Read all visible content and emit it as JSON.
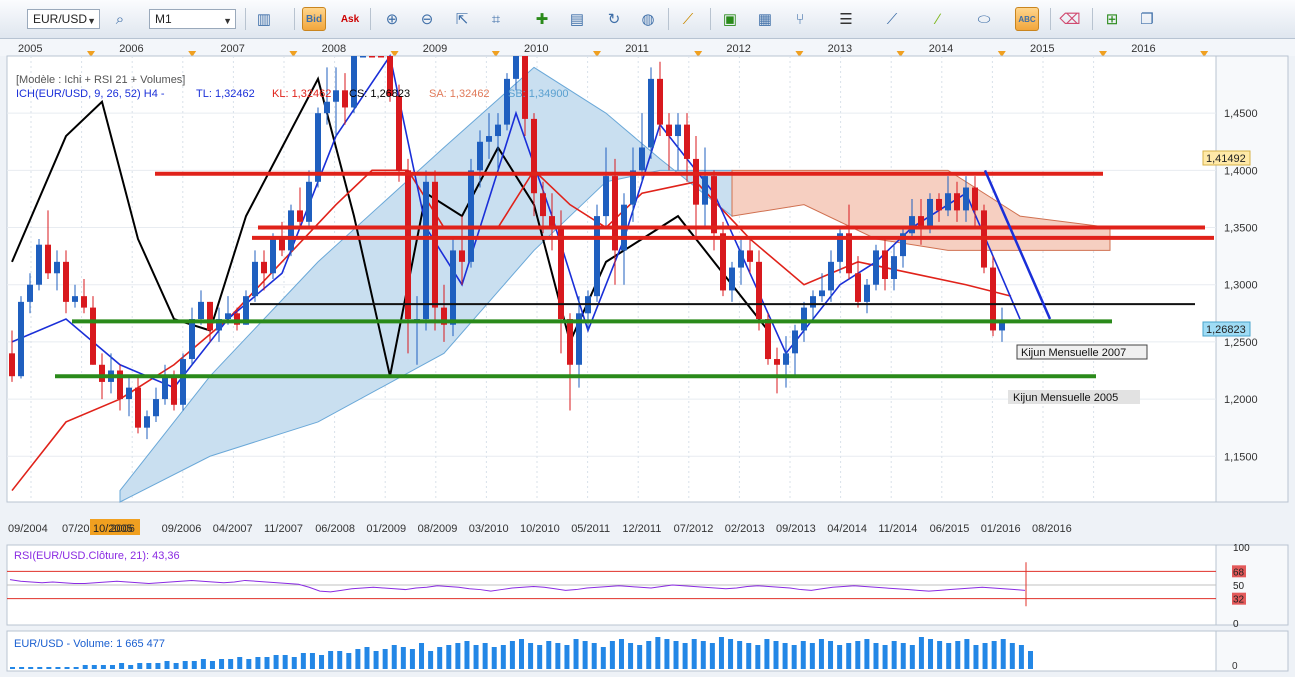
{
  "toolbar": {
    "symbol": "EUR/USD",
    "timeframe": "M1",
    "bid_label": "Bid",
    "ask_label": "Ask",
    "tool_icons": [
      "chart-type-icon",
      "indicator-icon",
      "zoom-in-icon",
      "zoom-out-icon",
      "cursor-icon",
      "fibonacci-icon",
      "note-icon",
      "refresh-icon",
      "globe-icon",
      "ruler-icon",
      "picture-icon",
      "screenshot-icon",
      "pitchfork-icon",
      "horizontal-lines-icon",
      "trendline-icon",
      "line-draw-icon",
      "ellipse-icon",
      "text-tool-icon",
      "eraser-icon",
      "tree-icon",
      "window-icon"
    ]
  },
  "main_chart": {
    "legend_line1": "[Modèle : Ichi + RSI 21 + Volumes]",
    "legend_ich": "ICH(EUR/USD, 9, 26, 52) H4 -",
    "legend_tl": "TL: 1,32462",
    "legend_kl": "KL: 1,32462",
    "legend_cs": "CS: 1,26823",
    "legend_sa": "SA: 1,32462",
    "legend_sb": "SB: 1,34900",
    "year_labels": [
      "2005",
      "2006",
      "2007",
      "2008",
      "2009",
      "2010",
      "2011",
      "2012",
      "2013",
      "2014",
      "2015",
      "2016"
    ],
    "date_labels": [
      "09/2004",
      "07/2005",
      "10/2005",
      "2006",
      "09/2006",
      "04/2007",
      "11/2007",
      "06/2008",
      "01/2009",
      "08/2009",
      "03/2010",
      "10/2010",
      "05/2011",
      "12/2011",
      "07/2012",
      "02/2013",
      "09/2013",
      "04/2014",
      "11/2014",
      "06/2015",
      "01/2016",
      "08/2016"
    ],
    "highlighted_date": "10/2005",
    "price_ticks": [
      "1,4500",
      "1,4000",
      "1,3500",
      "1,3000",
      "1,2500",
      "1,2000",
      "1,1500"
    ],
    "price_tag_high": "1,41492",
    "price_tag_last": "1,26823",
    "label_kijun_2007": "Kijun Mensuelle 2007",
    "label_kijun_2005": "Kijun Mensuelle 2005"
  },
  "rsi_panel": {
    "title": "RSI(EUR/USD.Clôture, 21): 43,36",
    "ticks": [
      "100",
      "68",
      "50",
      "32",
      "0"
    ]
  },
  "volume_panel": {
    "title": "EUR/USD - Volume: 1 665 477",
    "ticks": [
      "0"
    ]
  },
  "colors": {
    "bull": "#1f5fbf",
    "bear": "#d8191e",
    "kijun": "#e0221a",
    "tenkan": "#1a2fd8",
    "chikou": "#000000",
    "cloud_bull": "#c9dff0",
    "cloud_bear": "#f6cfc1",
    "support": "#2a8a1a",
    "rsi": "#8a2be2",
    "volume": "#2387e6"
  },
  "chart_data": {
    "type": "candlestick",
    "instrument": "EUR/USD",
    "interval": "monthly",
    "ylim": [
      1.11,
      1.5
    ],
    "candles_ohlc": [
      [
        1.24,
        1.26,
        1.215,
        1.22
      ],
      [
        1.22,
        1.29,
        1.218,
        1.285
      ],
      [
        1.285,
        1.31,
        1.275,
        1.3
      ],
      [
        1.3,
        1.34,
        1.295,
        1.335
      ],
      [
        1.335,
        1.365,
        1.305,
        1.31
      ],
      [
        1.31,
        1.33,
        1.295,
        1.32
      ],
      [
        1.32,
        1.33,
        1.275,
        1.285
      ],
      [
        1.285,
        1.3,
        1.28,
        1.29
      ],
      [
        1.29,
        1.305,
        1.275,
        1.28
      ],
      [
        1.28,
        1.29,
        1.23,
        1.23
      ],
      [
        1.23,
        1.24,
        1.2,
        1.215
      ],
      [
        1.215,
        1.24,
        1.205,
        1.225
      ],
      [
        1.225,
        1.23,
        1.19,
        1.2
      ],
      [
        1.2,
        1.22,
        1.185,
        1.21
      ],
      [
        1.21,
        1.22,
        1.17,
        1.175
      ],
      [
        1.175,
        1.19,
        1.165,
        1.185
      ],
      [
        1.185,
        1.21,
        1.18,
        1.2
      ],
      [
        1.2,
        1.23,
        1.195,
        1.22
      ],
      [
        1.22,
        1.225,
        1.19,
        1.195
      ],
      [
        1.195,
        1.24,
        1.19,
        1.235
      ],
      [
        1.235,
        1.28,
        1.23,
        1.27
      ],
      [
        1.27,
        1.295,
        1.265,
        1.285
      ],
      [
        1.285,
        1.285,
        1.25,
        1.26
      ],
      [
        1.26,
        1.28,
        1.25,
        1.27
      ],
      [
        1.27,
        1.29,
        1.265,
        1.275
      ],
      [
        1.275,
        1.28,
        1.26,
        1.265
      ],
      [
        1.265,
        1.295,
        1.265,
        1.29
      ],
      [
        1.29,
        1.33,
        1.285,
        1.32
      ],
      [
        1.32,
        1.33,
        1.295,
        1.31
      ],
      [
        1.31,
        1.345,
        1.305,
        1.34
      ],
      [
        1.34,
        1.355,
        1.325,
        1.33
      ],
      [
        1.33,
        1.37,
        1.325,
        1.365
      ],
      [
        1.365,
        1.385,
        1.35,
        1.355
      ],
      [
        1.355,
        1.4,
        1.35,
        1.39
      ],
      [
        1.39,
        1.455,
        1.385,
        1.45
      ],
      [
        1.45,
        1.49,
        1.44,
        1.46
      ],
      [
        1.46,
        1.49,
        1.43,
        1.47
      ],
      [
        1.47,
        1.485,
        1.44,
        1.455
      ],
      [
        1.455,
        1.55,
        1.45,
        1.53
      ],
      [
        1.53,
        1.59,
        1.52,
        1.58
      ],
      [
        1.58,
        1.6,
        1.54,
        1.56
      ],
      [
        1.56,
        1.58,
        1.55,
        1.555
      ],
      [
        1.555,
        1.56,
        1.46,
        1.465
      ],
      [
        1.465,
        1.475,
        1.39,
        1.4
      ],
      [
        1.4,
        1.41,
        1.24,
        1.27
      ],
      [
        1.27,
        1.29,
        1.23,
        1.27
      ],
      [
        1.27,
        1.4,
        1.26,
        1.39
      ],
      [
        1.39,
        1.4,
        1.26,
        1.28
      ],
      [
        1.28,
        1.3,
        1.25,
        1.265
      ],
      [
        1.265,
        1.34,
        1.255,
        1.33
      ],
      [
        1.33,
        1.36,
        1.3,
        1.32
      ],
      [
        1.32,
        1.41,
        1.315,
        1.4
      ],
      [
        1.4,
        1.435,
        1.385,
        1.425
      ],
      [
        1.425,
        1.45,
        1.41,
        1.43
      ],
      [
        1.43,
        1.45,
        1.4,
        1.44
      ],
      [
        1.44,
        1.485,
        1.435,
        1.48
      ],
      [
        1.48,
        1.515,
        1.47,
        1.5
      ],
      [
        1.5,
        1.51,
        1.43,
        1.445
      ],
      [
        1.445,
        1.45,
        1.36,
        1.38
      ],
      [
        1.38,
        1.39,
        1.345,
        1.36
      ],
      [
        1.36,
        1.38,
        1.33,
        1.35
      ],
      [
        1.35,
        1.365,
        1.24,
        1.27
      ],
      [
        1.27,
        1.275,
        1.19,
        1.23
      ],
      [
        1.23,
        1.29,
        1.21,
        1.275
      ],
      [
        1.275,
        1.295,
        1.26,
        1.29
      ],
      [
        1.29,
        1.37,
        1.285,
        1.36
      ],
      [
        1.36,
        1.42,
        1.35,
        1.395
      ],
      [
        1.395,
        1.41,
        1.3,
        1.33
      ],
      [
        1.33,
        1.38,
        1.3,
        1.37
      ],
      [
        1.37,
        1.42,
        1.355,
        1.4
      ],
      [
        1.4,
        1.45,
        1.39,
        1.42
      ],
      [
        1.42,
        1.49,
        1.41,
        1.48
      ],
      [
        1.48,
        1.495,
        1.43,
        1.44
      ],
      [
        1.44,
        1.45,
        1.4,
        1.43
      ],
      [
        1.43,
        1.45,
        1.4,
        1.44
      ],
      [
        1.44,
        1.45,
        1.39,
        1.41
      ],
      [
        1.41,
        1.43,
        1.34,
        1.37
      ],
      [
        1.37,
        1.42,
        1.35,
        1.395
      ],
      [
        1.395,
        1.4,
        1.33,
        1.345
      ],
      [
        1.345,
        1.355,
        1.29,
        1.295
      ],
      [
        1.295,
        1.32,
        1.285,
        1.315
      ],
      [
        1.315,
        1.34,
        1.3,
        1.33
      ],
      [
        1.33,
        1.34,
        1.31,
        1.32
      ],
      [
        1.32,
        1.33,
        1.26,
        1.27
      ],
      [
        1.27,
        1.275,
        1.23,
        1.235
      ],
      [
        1.235,
        1.245,
        1.205,
        1.23
      ],
      [
        1.23,
        1.255,
        1.21,
        1.24
      ],
      [
        1.24,
        1.265,
        1.22,
        1.26
      ],
      [
        1.26,
        1.285,
        1.25,
        1.28
      ],
      [
        1.28,
        1.295,
        1.27,
        1.29
      ],
      [
        1.29,
        1.31,
        1.285,
        1.295
      ],
      [
        1.295,
        1.33,
        1.285,
        1.32
      ],
      [
        1.32,
        1.35,
        1.31,
        1.345
      ],
      [
        1.345,
        1.37,
        1.305,
        1.31
      ],
      [
        1.31,
        1.325,
        1.28,
        1.285
      ],
      [
        1.285,
        1.305,
        1.275,
        1.3
      ],
      [
        1.3,
        1.335,
        1.295,
        1.33
      ],
      [
        1.33,
        1.34,
        1.295,
        1.305
      ],
      [
        1.305,
        1.335,
        1.295,
        1.325
      ],
      [
        1.325,
        1.35,
        1.315,
        1.345
      ],
      [
        1.345,
        1.375,
        1.34,
        1.36
      ],
      [
        1.36,
        1.375,
        1.335,
        1.35
      ],
      [
        1.35,
        1.38,
        1.345,
        1.375
      ],
      [
        1.375,
        1.38,
        1.355,
        1.365
      ],
      [
        1.365,
        1.395,
        1.36,
        1.38
      ],
      [
        1.38,
        1.39,
        1.355,
        1.365
      ],
      [
        1.365,
        1.395,
        1.355,
        1.385
      ],
      [
        1.385,
        1.395,
        1.35,
        1.365
      ],
      [
        1.365,
        1.37,
        1.31,
        1.315
      ],
      [
        1.315,
        1.325,
        1.255,
        1.26
      ],
      [
        1.26,
        1.28,
        1.25,
        1.2682
      ]
    ],
    "tenkan": [
      [
        0,
        1.25
      ],
      [
        6,
        1.27
      ],
      [
        12,
        1.23
      ],
      [
        18,
        1.21
      ],
      [
        24,
        1.27
      ],
      [
        30,
        1.31
      ],
      [
        36,
        1.43
      ],
      [
        42,
        1.52
      ],
      [
        46,
        1.35
      ],
      [
        50,
        1.3
      ],
      [
        56,
        1.45
      ],
      [
        60,
        1.36
      ],
      [
        64,
        1.26
      ],
      [
        68,
        1.34
      ],
      [
        72,
        1.44
      ],
      [
        78,
        1.38
      ],
      [
        82,
        1.31
      ],
      [
        86,
        1.24
      ],
      [
        92,
        1.3
      ],
      [
        96,
        1.32
      ],
      [
        100,
        1.35
      ],
      [
        106,
        1.38
      ],
      [
        112,
        1.27
      ]
    ],
    "kijun": [
      [
        0,
        1.12
      ],
      [
        6,
        1.18
      ],
      [
        12,
        1.2
      ],
      [
        18,
        1.23
      ],
      [
        24,
        1.27
      ],
      [
        30,
        1.32
      ],
      [
        36,
        1.37
      ],
      [
        40,
        1.4
      ],
      [
        44,
        1.4
      ],
      [
        48,
        1.35
      ],
      [
        54,
        1.35
      ],
      [
        58,
        1.4
      ],
      [
        62,
        1.37
      ],
      [
        66,
        1.35
      ],
      [
        70,
        1.38
      ],
      [
        76,
        1.39
      ],
      [
        82,
        1.34
      ],
      [
        88,
        1.3
      ],
      [
        94,
        1.32
      ],
      [
        100,
        1.31
      ],
      [
        106,
        1.3
      ],
      [
        111,
        1.29
      ]
    ],
    "chikou": [
      [
        0,
        1.32
      ],
      [
        6,
        1.43
      ],
      [
        10,
        1.46
      ],
      [
        14,
        1.34
      ],
      [
        18,
        1.27
      ],
      [
        22,
        1.26
      ],
      [
        26,
        1.36
      ],
      [
        30,
        1.42
      ],
      [
        34,
        1.48
      ],
      [
        38,
        1.36
      ],
      [
        42,
        1.22
      ],
      [
        46,
        1.38
      ],
      [
        50,
        1.36
      ],
      [
        54,
        1.42
      ],
      [
        58,
        1.37
      ],
      [
        62,
        1.25
      ],
      [
        66,
        1.32
      ],
      [
        70,
        1.34
      ],
      [
        74,
        1.36
      ],
      [
        78,
        1.32
      ],
      [
        84,
        1.26
      ]
    ],
    "cloud_span_a": [
      [
        12,
        1.12
      ],
      [
        22,
        1.22
      ],
      [
        34,
        1.32
      ],
      [
        48,
        1.42
      ],
      [
        58,
        1.49
      ],
      [
        66,
        1.45
      ],
      [
        72,
        1.41
      ],
      [
        80,
        1.36
      ],
      [
        88,
        1.37
      ],
      [
        96,
        1.34
      ],
      [
        104,
        1.33
      ],
      [
        112,
        1.33
      ],
      [
        122,
        1.33
      ]
    ],
    "cloud_span_b": [
      [
        12,
        1.1
      ],
      [
        22,
        1.15
      ],
      [
        34,
        1.18
      ],
      [
        48,
        1.24
      ],
      [
        58,
        1.33
      ],
      [
        66,
        1.39
      ],
      [
        72,
        1.4
      ],
      [
        80,
        1.4
      ],
      [
        88,
        1.4
      ],
      [
        96,
        1.4
      ],
      [
        104,
        1.4
      ],
      [
        112,
        1.36
      ],
      [
        122,
        1.35
      ]
    ],
    "horizontal_levels": [
      {
        "price": 1.397,
        "color": "red"
      },
      {
        "price": 1.35,
        "color": "red"
      },
      {
        "price": 1.341,
        "color": "red"
      },
      {
        "price": 1.283,
        "color": "black"
      },
      {
        "price": 1.268,
        "color": "green",
        "label": "Kijun Mensuelle 2007"
      },
      {
        "price": 1.22,
        "color": "green",
        "label": "Kijun Mensuelle 2005"
      }
    ],
    "trendline": [
      [
        1.4,
        0
      ],
      [
        1.27,
        1
      ]
    ],
    "rsi": {
      "ylim": [
        0,
        100
      ],
      "last": 43.36,
      "levels": [
        32,
        50,
        68
      ],
      "values": [
        57,
        55,
        54,
        53,
        54,
        53,
        52,
        52,
        53,
        54,
        55,
        54,
        53,
        52,
        53,
        54,
        55,
        56,
        55,
        54,
        53,
        54,
        56,
        55,
        54,
        53,
        52,
        51,
        47,
        42,
        41,
        43,
        45,
        46,
        47,
        46,
        45,
        44,
        46,
        47,
        49,
        48,
        47,
        45,
        44,
        42,
        44,
        46,
        47,
        48,
        47,
        45,
        43,
        44,
        46,
        47,
        48,
        49,
        48,
        47,
        46,
        48,
        50,
        49,
        48,
        47,
        46,
        45,
        46,
        48,
        49,
        48,
        47,
        46,
        44,
        43,
        45,
        47,
        48,
        49,
        48,
        47,
        46,
        45,
        44,
        43,
        42,
        43,
        44,
        45,
        46,
        47,
        46,
        45,
        44,
        43
      ]
    },
    "volume": {
      "values": [
        1,
        1,
        1,
        1,
        1,
        1,
        1,
        1,
        2,
        2,
        2,
        2,
        3,
        2,
        3,
        3,
        3,
        4,
        3,
        4,
        4,
        5,
        4,
        5,
        5,
        6,
        5,
        6,
        6,
        7,
        7,
        6,
        8,
        8,
        7,
        9,
        9,
        8,
        10,
        11,
        9,
        10,
        12,
        11,
        10,
        13,
        9,
        11,
        12,
        13,
        14,
        12,
        13,
        11,
        12,
        14,
        15,
        13,
        12,
        14,
        13,
        12,
        15,
        14,
        13,
        11,
        14,
        15,
        13,
        12,
        14,
        16,
        15,
        14,
        13,
        15,
        14,
        13,
        16,
        15,
        14,
        13,
        12,
        15,
        14,
        13,
        12,
        14,
        13,
        15,
        14,
        12,
        13,
        14,
        15,
        13,
        12,
        14,
        13,
        12,
        16,
        15,
        14,
        13,
        14,
        15,
        12,
        13,
        14,
        15,
        13,
        12,
        9
      ]
    }
  }
}
